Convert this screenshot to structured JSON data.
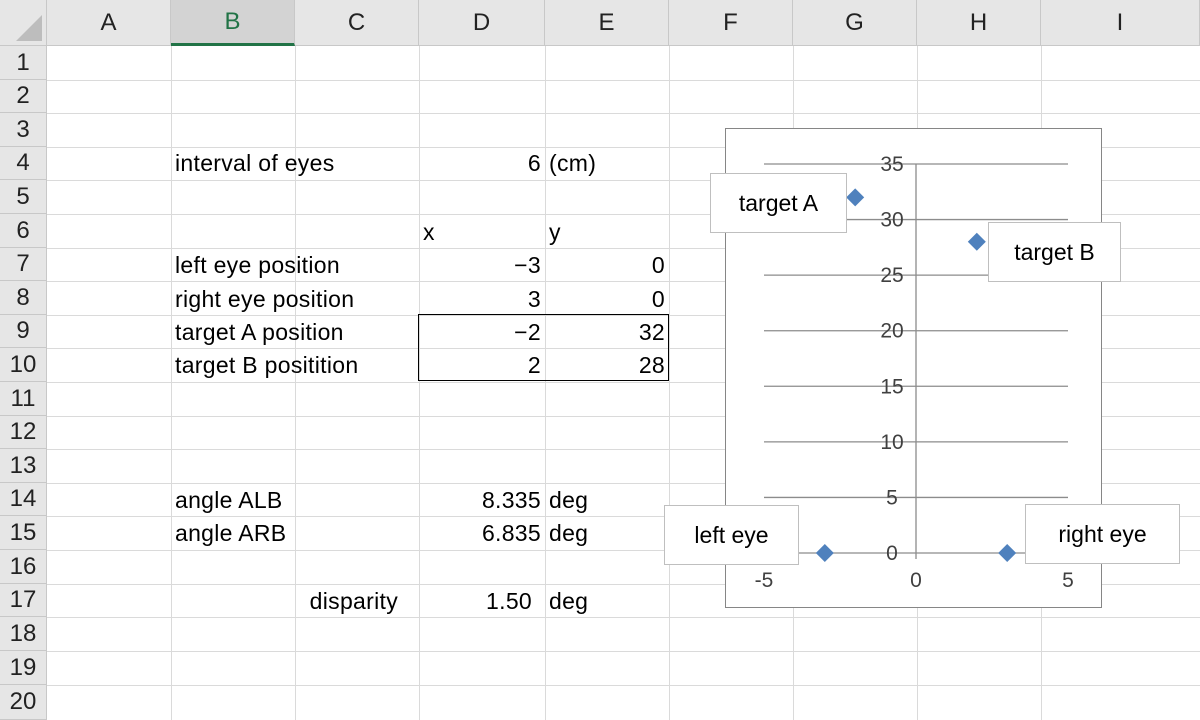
{
  "columns": [
    "A",
    "B",
    "C",
    "D",
    "E",
    "F",
    "G",
    "H",
    "I"
  ],
  "rows": [
    "1",
    "2",
    "3",
    "4",
    "5",
    "6",
    "7",
    "8",
    "9",
    "10",
    "11",
    "12",
    "13",
    "14",
    "15",
    "16",
    "17",
    "18",
    "19",
    "20"
  ],
  "cells": {
    "B4": "interval of eyes",
    "D4": "6",
    "E4": "(cm)",
    "D6": "x",
    "E6": "y",
    "B7": "left eye position",
    "D7": "−3",
    "E7": "0",
    "B8": "right eye position",
    "D8": "3",
    "E8": "0",
    "B9": "target A position",
    "D9": "−2",
    "E9": "32",
    "B10": "target B positition",
    "D10": "2",
    "E10": "28",
    "B14": "angle ALB",
    "D14": "8.335",
    "E14": "deg",
    "B15": "angle ARB",
    "D15": "6.835",
    "E15": "deg",
    "C17": "disparity",
    "D17": "1.50",
    "E17": "deg"
  },
  "colors": {
    "header_bg": "#e6e6e6",
    "selected_header_text": "#217346",
    "grid": "#dadada",
    "marker": "#4f81bd"
  },
  "chart_data": {
    "type": "scatter",
    "series": [
      {
        "points": [
          {
            "x": -3,
            "y": 0,
            "label": "left eye"
          },
          {
            "x": 3,
            "y": 0,
            "label": "right eye"
          },
          {
            "x": -2,
            "y": 32,
            "label": "target A"
          },
          {
            "x": 2,
            "y": 28,
            "label": "target B"
          }
        ]
      }
    ],
    "xlim": [
      -5,
      5
    ],
    "ylim": [
      0,
      35
    ],
    "xticks": [
      "-5",
      "0",
      "5"
    ],
    "yticks": [
      "0",
      "5",
      "10",
      "15",
      "20",
      "25",
      "30",
      "35"
    ],
    "grid": "horizontal",
    "marker": "diamond",
    "legend": "none"
  }
}
